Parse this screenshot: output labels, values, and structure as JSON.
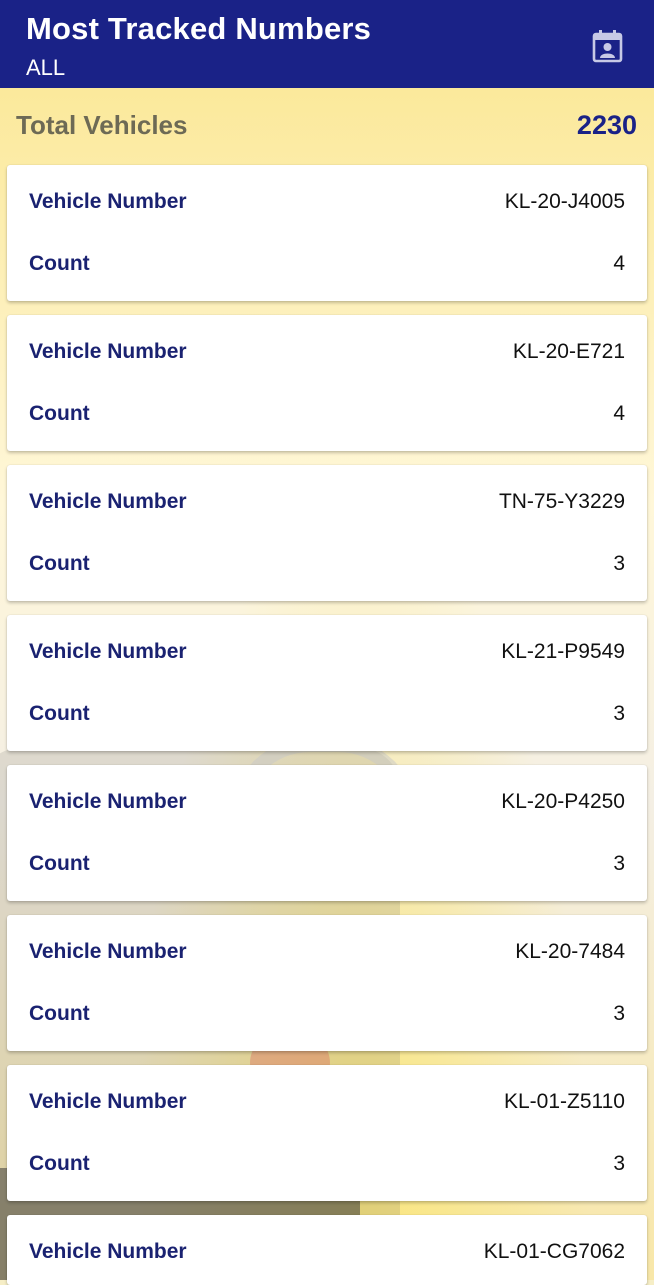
{
  "header": {
    "title": "Most Tracked Numbers",
    "subtitle": "ALL",
    "action_icon": "calendar-contact-icon"
  },
  "summary": {
    "label": "Total Vehicles",
    "value": "2230"
  },
  "labels": {
    "vehicle_number": "Vehicle Number",
    "count": "Count"
  },
  "vehicles": [
    {
      "number": "KL-20-J4005",
      "count": "4"
    },
    {
      "number": "KL-20-E721",
      "count": "4"
    },
    {
      "number": "TN-75-Y3229",
      "count": "3"
    },
    {
      "number": "KL-21-P9549",
      "count": "3"
    },
    {
      "number": "KL-20-P4250",
      "count": "3"
    },
    {
      "number": "KL-20-7484",
      "count": "3"
    },
    {
      "number": "KL-01-Z5110",
      "count": "3"
    },
    {
      "number": "KL-01-CG7062",
      "count": ""
    }
  ],
  "colors": {
    "appbar": "#1a2287",
    "label_text": "#1a2271",
    "summary_label": "#6d6a55"
  }
}
